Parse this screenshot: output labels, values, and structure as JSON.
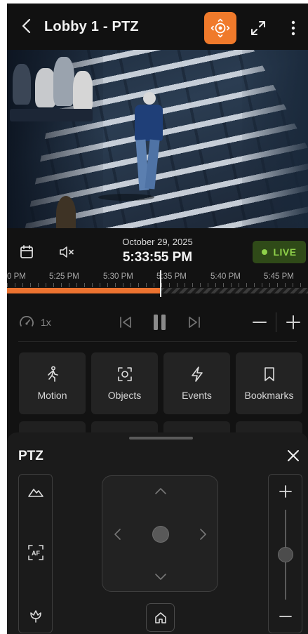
{
  "header": {
    "title": "Lobby 1 - PTZ",
    "icons": {
      "back": "chevron-left-icon",
      "ptz": "ptz-joystick-icon",
      "fullscreen": "expand-icon",
      "more": "more-vertical-icon"
    },
    "accent": "#f07a2b"
  },
  "playback": {
    "date": "October 29, 2025",
    "time": "5:33:55 PM",
    "live_label": "LIVE",
    "live_color": "#8fd14a",
    "speed": "1x"
  },
  "timeline": {
    "ticks": [
      "0 PM",
      "5:25 PM",
      "5:30 PM",
      "5:35 PM",
      "5:40 PM",
      "5:45 PM"
    ],
    "recorded_color": "#ec7330",
    "recorded_fraction": 0.51
  },
  "actions": [
    {
      "label": "Motion",
      "icon": "motion-icon"
    },
    {
      "label": "Objects",
      "icon": "objects-icon"
    },
    {
      "label": "Events",
      "icon": "events-icon"
    },
    {
      "label": "Bookmarks",
      "icon": "bookmark-icon"
    }
  ],
  "ptz": {
    "title": "PTZ",
    "focus_label": "AF",
    "zoom_level": 0.5
  }
}
